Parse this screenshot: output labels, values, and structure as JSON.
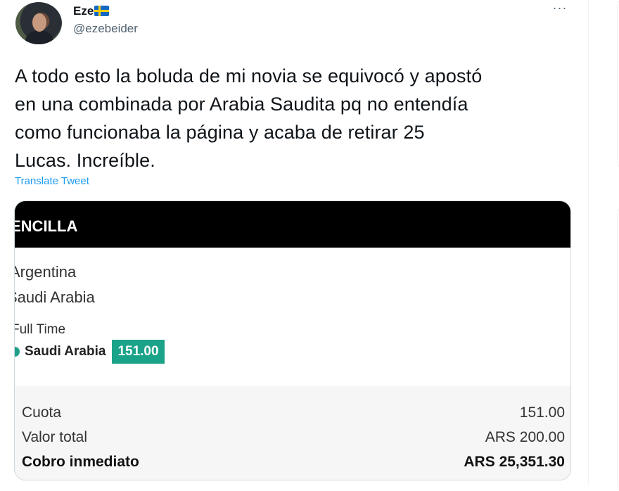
{
  "tweet": {
    "display_name": "Eze",
    "flag_icon": "sweden-flag-icon",
    "handle": "@ezebeider",
    "more_label": "···",
    "text": "A todo esto la boluda de mi novia se equivocó y apostó\nen una combinada por Arabia Saudita pq no entendía\ncomo funcionaba la página y acaba de retirar 25\nLucas. Increíble.",
    "translate_label": "Translate Tweet"
  },
  "bet_slip": {
    "header": "ENCILLA",
    "team_1": "Argentina",
    "team_2": "Saudi Arabia",
    "market": "Full Time",
    "selection": "Saudi Arabia",
    "odds": "151.00",
    "summary": [
      {
        "label": "Cuota",
        "value": "151.00",
        "bold": false
      },
      {
        "label": "Valor total",
        "value": "ARS 200.00",
        "bold": false
      },
      {
        "label": "Cobro inmediato",
        "value": "ARS 25,351.30",
        "bold": true
      }
    ]
  },
  "colors": {
    "link": "#1d9bf0",
    "odds_badge": "#1ba38a",
    "header_bg": "#000000",
    "handle": "#536471"
  }
}
